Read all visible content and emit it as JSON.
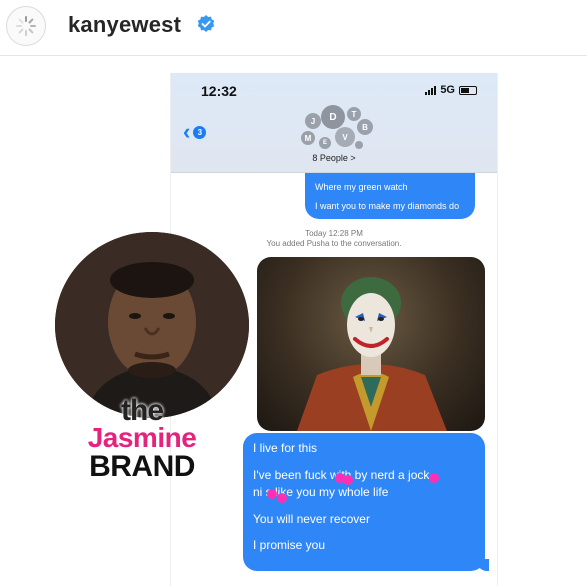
{
  "post_header": {
    "username": "kanyewest",
    "verified": true,
    "avatar_icon": "loading-spinner-icon"
  },
  "phone": {
    "status": {
      "time": "12:32",
      "network": "5G"
    },
    "back_badge": "3",
    "group": {
      "avatar_letters": [
        "J",
        "D",
        "T",
        "M",
        "V",
        "B",
        "E"
      ],
      "name": "8 People >"
    },
    "messages": {
      "outgoing_top": [
        "Where my green watch",
        "I want you to make my diamonds do"
      ],
      "system_time": "Today 12:28 PM",
      "system_event": "You added Pusha to the conversation.",
      "outgoing_main": [
        "I live for this",
        "I've been fuck  with by nerd a  jock",
        "ni  s like you my whole life",
        "You will never recover",
        "I promise you"
      ]
    }
  },
  "watermark": {
    "line1": "the",
    "line2": "Jasmine",
    "line3": "BRAND"
  },
  "colors": {
    "imessage_blue": "#2f86f6",
    "brand_pink": "#e4237d",
    "verified_blue": "#3897f0",
    "censor_dot": "#ff2fb3"
  }
}
